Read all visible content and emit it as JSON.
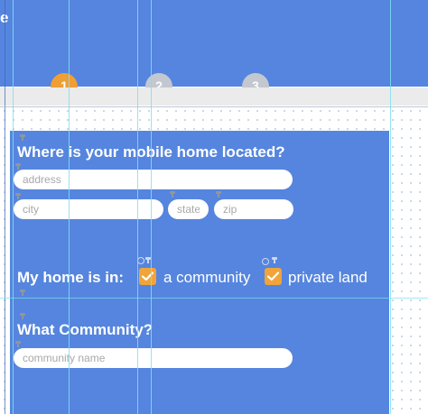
{
  "header": {
    "title_fragment": "e",
    "steps": [
      {
        "label": "1",
        "state": "active",
        "color": "#ee9f35"
      },
      {
        "label": "2",
        "state": "pending",
        "color": "#c3c8d0"
      },
      {
        "label": "3",
        "state": "pending",
        "color": "#c3c8d0"
      }
    ]
  },
  "colors": {
    "panel": "#5585de",
    "accent": "#f0a43a",
    "guide": "#7ee0f0"
  },
  "location": {
    "title": "Where is your mobile home located?",
    "address_placeholder": "address",
    "city_placeholder": "city",
    "state_placeholder": "state",
    "zip_placeholder": "zip"
  },
  "home_type": {
    "label": "My home is in:",
    "options": [
      {
        "label": "a community",
        "checked": true
      },
      {
        "label": "private land",
        "checked": true
      }
    ]
  },
  "community": {
    "title": "What Community?",
    "name_placeholder": "community name"
  },
  "icons": {
    "pin": "pin-icon",
    "check": "checkmark-icon",
    "gear": "gear-icon"
  }
}
